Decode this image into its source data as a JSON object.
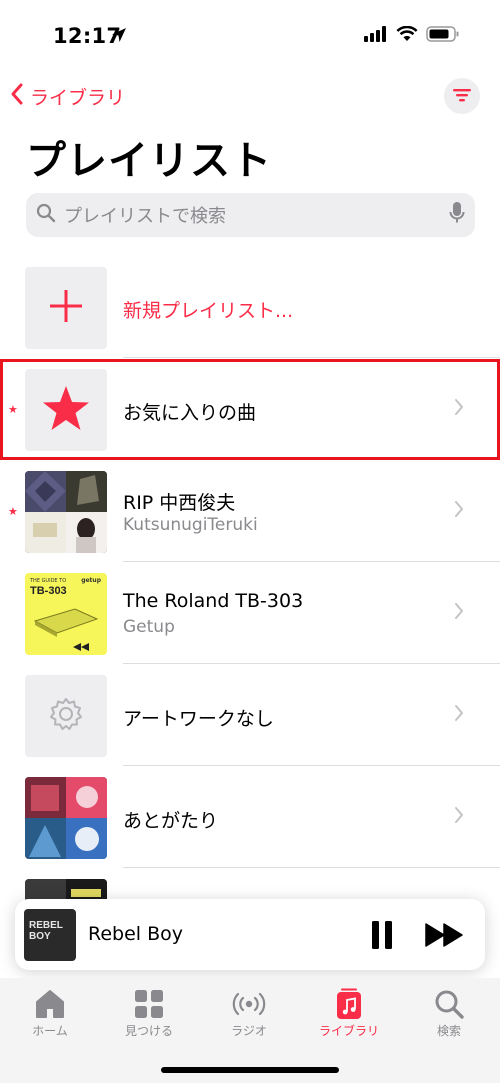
{
  "status": {
    "time": "12:17"
  },
  "nav": {
    "back_label": "ライブラリ"
  },
  "page": {
    "title": "プレイリスト"
  },
  "search": {
    "placeholder": "プレイリストで検索"
  },
  "playlists": [
    {
      "title": "新規プレイリスト...",
      "subtitle": "",
      "kind": "new",
      "favorite": false
    },
    {
      "title": "お気に入りの曲",
      "subtitle": "",
      "kind": "star",
      "favorite": true,
      "highlighted": true
    },
    {
      "title": "RIP 中西俊夫",
      "subtitle": "KutsunugiTeruki",
      "kind": "collage",
      "favorite": true
    },
    {
      "title": "The Roland TB-303",
      "subtitle": "Getup",
      "kind": "tb303",
      "favorite": false
    },
    {
      "title": "アートワークなし",
      "subtitle": "",
      "kind": "none",
      "favorite": false
    },
    {
      "title": "あとがたり",
      "subtitle": "",
      "kind": "anime",
      "favorite": false
    }
  ],
  "art_text": {
    "tb303_small": "THE GUIDE TO",
    "tb303_big": "TB-303",
    "tb303_brand": "getup",
    "mini_art": "REBEL\nBOY"
  },
  "now_playing": {
    "title": "Rebel Boy"
  },
  "tabs": [
    {
      "label": "ホーム",
      "icon": "home-icon",
      "active": false
    },
    {
      "label": "見つける",
      "icon": "grid-icon",
      "active": false
    },
    {
      "label": "ラジオ",
      "icon": "radio-icon",
      "active": false
    },
    {
      "label": "ライブラリ",
      "icon": "music-library-icon",
      "active": true
    },
    {
      "label": "検索",
      "icon": "search-icon",
      "active": false
    }
  ],
  "colors": {
    "accent": "#fa2d48",
    "highlight_border": "#e8141e",
    "secondary_text": "#8a8a8e"
  }
}
